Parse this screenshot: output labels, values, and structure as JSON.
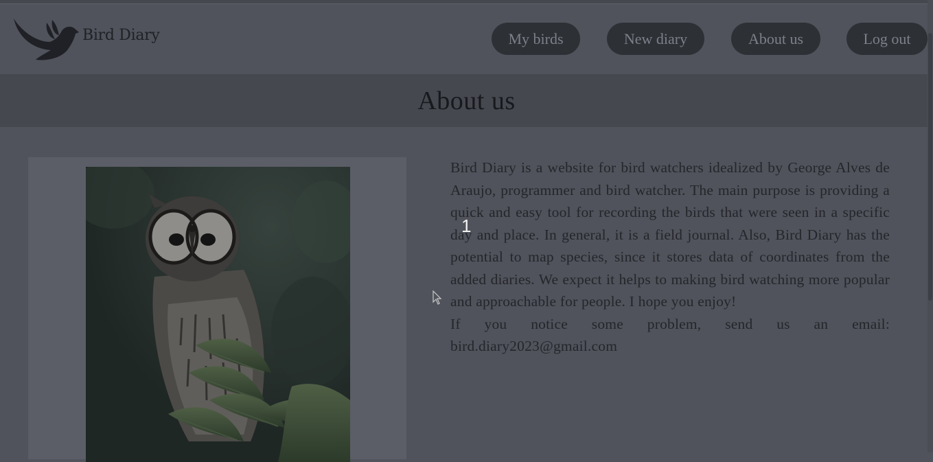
{
  "header": {
    "brand": "Bird Diary",
    "nav": [
      {
        "label": "My birds"
      },
      {
        "label": "New diary"
      },
      {
        "label": "About us"
      },
      {
        "label": "Log out"
      }
    ]
  },
  "page": {
    "title": "About us"
  },
  "about": {
    "paragraph1": "Bird Diary is a website for bird watchers idealized by George Alves de Araujo, programmer and bird watcher. The main purpose is providing a quick and easy tool for recording the birds that were seen in a specific day and place. In general, it is a field journal. Also, Bird Diary has the potential to map species, since it stores data of coordinates from the added diaries. We expect it helps to making bird watching more popular and approachable for people. I hope you enjoy!",
    "paragraph2": "If you notice some problem, send us an email: bird.diary2023@gmail.com"
  },
  "overlay": {
    "step_marker": "1"
  },
  "icons": {
    "logo": "bird-logo-icon",
    "cursor": "mouse-pointer-icon"
  },
  "colors": {
    "page_bg": "#50535b",
    "band_bg": "#45484f",
    "button_bg": "#2d3035",
    "button_text": "#7d8089"
  }
}
